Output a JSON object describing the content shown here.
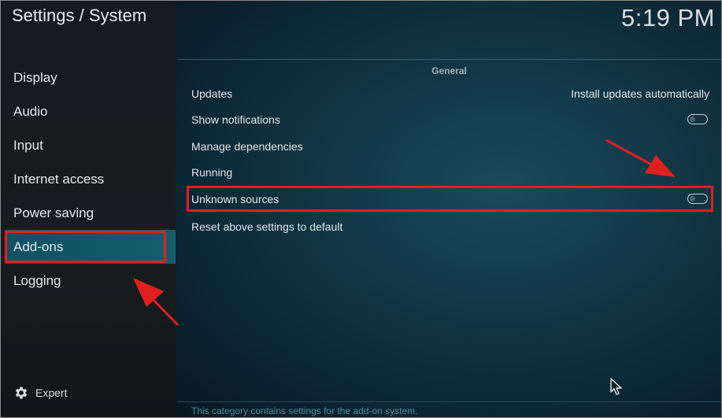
{
  "header": {
    "title": "Settings / System",
    "clock": "5:19 PM"
  },
  "sidebar": {
    "items": [
      {
        "label": "Display"
      },
      {
        "label": "Audio"
      },
      {
        "label": "Input"
      },
      {
        "label": "Internet access"
      },
      {
        "label": "Power saving"
      },
      {
        "label": "Add-ons",
        "active": true
      },
      {
        "label": "Logging"
      }
    ],
    "expert_label": "Expert",
    "expert_icon": "gear-icon"
  },
  "main": {
    "section_title": "General",
    "settings": [
      {
        "label": "Updates",
        "value": "Install updates automatically"
      },
      {
        "label": "Show notifications",
        "toggle": "off"
      },
      {
        "label": "Manage dependencies"
      },
      {
        "label": "Running"
      },
      {
        "label": "Unknown sources",
        "toggle": "off",
        "highlighted": true
      },
      {
        "label": "Reset above settings to default"
      }
    ],
    "footer_text": "This category contains settings for the add-on system."
  },
  "colors": {
    "highlight": "#e02020",
    "active_item": "#145c6d",
    "background": "#123747"
  }
}
